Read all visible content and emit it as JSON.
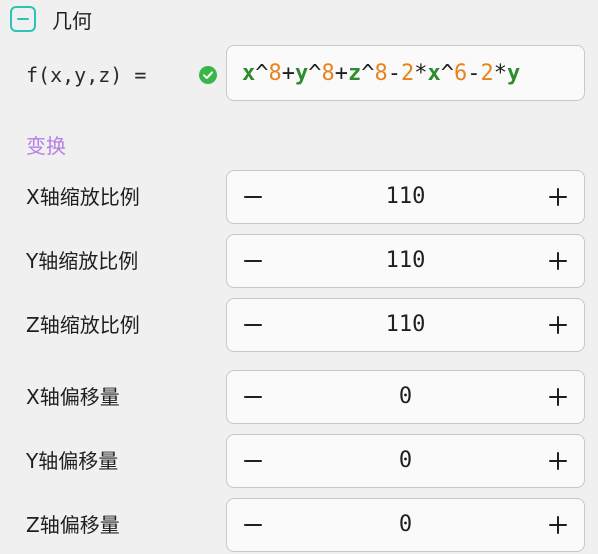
{
  "section": {
    "title": "几何",
    "collapse_icon": "minus-icon",
    "accent_color": "#2bc4b4"
  },
  "function": {
    "label": "f(x,y,z) =",
    "status_icon": "check-circle-icon",
    "status_color": "#3bb54a",
    "expression": "x^8+y^8+z^8-2*x^6-2*y",
    "tokens": [
      {
        "t": "x",
        "k": "var"
      },
      {
        "t": "^",
        "k": "op"
      },
      {
        "t": "8",
        "k": "num"
      },
      {
        "t": "+",
        "k": "op"
      },
      {
        "t": "y",
        "k": "var"
      },
      {
        "t": "^",
        "k": "op"
      },
      {
        "t": "8",
        "k": "num"
      },
      {
        "t": "+",
        "k": "op"
      },
      {
        "t": "z",
        "k": "var"
      },
      {
        "t": "^",
        "k": "op"
      },
      {
        "t": "8",
        "k": "num"
      },
      {
        "t": "-",
        "k": "op"
      },
      {
        "t": "2",
        "k": "num"
      },
      {
        "t": "*",
        "k": "op"
      },
      {
        "t": "x",
        "k": "var"
      },
      {
        "t": "^",
        "k": "op"
      },
      {
        "t": "6",
        "k": "num"
      },
      {
        "t": "-",
        "k": "op"
      },
      {
        "t": "2",
        "k": "num"
      },
      {
        "t": "*",
        "k": "op"
      },
      {
        "t": "y",
        "k": "var"
      }
    ]
  },
  "transform": {
    "title": "变换",
    "title_color": "#b57ee6",
    "rows": [
      {
        "label": "X轴缩放比例",
        "value": "110",
        "minus": "−",
        "plus": "+"
      },
      {
        "label": "Y轴缩放比例",
        "value": "110",
        "minus": "−",
        "plus": "+"
      },
      {
        "label": "Z轴缩放比例",
        "value": "110",
        "minus": "−",
        "plus": "+"
      },
      {
        "label": "X轴偏移量",
        "value": "0",
        "minus": "−",
        "plus": "+"
      },
      {
        "label": "Y轴偏移量",
        "value": "0",
        "minus": "−",
        "plus": "+"
      },
      {
        "label": "Z轴偏移量",
        "value": "0",
        "minus": "−",
        "plus": "+"
      }
    ]
  }
}
